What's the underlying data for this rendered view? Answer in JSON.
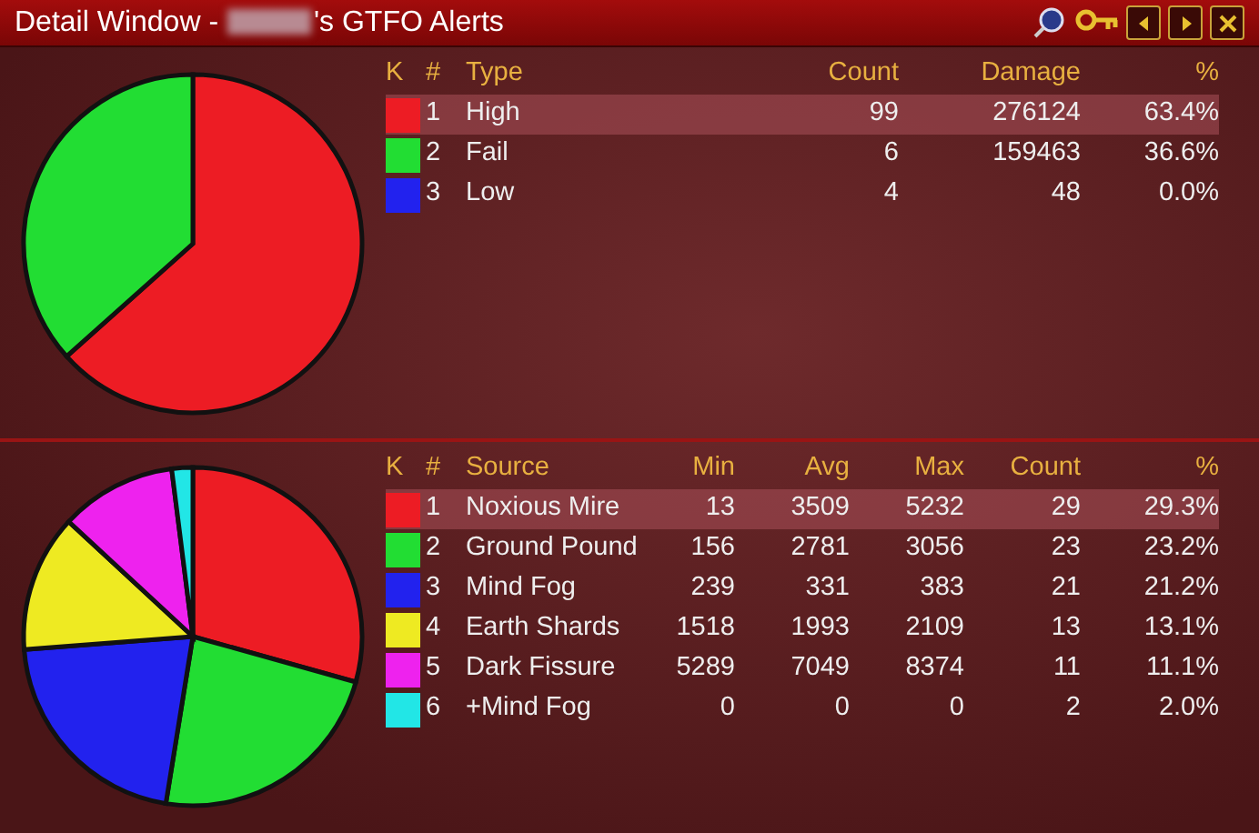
{
  "window": {
    "title_prefix": "Detail Window - ",
    "title_suffix": "'s GTFO Alerts"
  },
  "panels": [
    {
      "columns": [
        "K",
        "#",
        "Type",
        "Count",
        "Damage",
        "%"
      ],
      "rows": [
        {
          "color": "#ed1c24",
          "cells": [
            "",
            "1",
            "High",
            "99",
            "276124",
            "63.4%"
          ],
          "selected": true
        },
        {
          "color": "#22dd33",
          "cells": [
            "",
            "2",
            "Fail",
            "6",
            "159463",
            "36.6%"
          ],
          "selected": false
        },
        {
          "color": "#2222ee",
          "cells": [
            "",
            "3",
            "Low",
            "4",
            "48",
            "0.0%"
          ],
          "selected": false
        }
      ],
      "chart_data": {
        "type": "pie",
        "values": [
          63.4,
          36.6,
          0.0
        ]
      }
    },
    {
      "columns": [
        "K",
        "#",
        "Source",
        "Min",
        "Avg",
        "Max",
        "Count",
        "%"
      ],
      "rows": [
        {
          "color": "#ed1c24",
          "cells": [
            "",
            "1",
            "Noxious Mire",
            "13",
            "3509",
            "5232",
            "29",
            "29.3%"
          ],
          "selected": true
        },
        {
          "color": "#22dd33",
          "cells": [
            "",
            "2",
            "Ground Pound",
            "156",
            "2781",
            "3056",
            "23",
            "23.2%"
          ],
          "selected": false
        },
        {
          "color": "#2222ee",
          "cells": [
            "",
            "3",
            "Mind Fog",
            "239",
            "331",
            "383",
            "21",
            "21.2%"
          ],
          "selected": false
        },
        {
          "color": "#eeea22",
          "cells": [
            "",
            "4",
            "Earth Shards",
            "1518",
            "1993",
            "2109",
            "13",
            "13.1%"
          ],
          "selected": false
        },
        {
          "color": "#ee22ee",
          "cells": [
            "",
            "5",
            "Dark Fissure",
            "5289",
            "7049",
            "8374",
            "11",
            "11.1%"
          ],
          "selected": false
        },
        {
          "color": "#22e6e6",
          "cells": [
            "",
            "6",
            "+Mind Fog",
            "0",
            "0",
            "0",
            "2",
            "2.0%"
          ],
          "selected": false
        }
      ],
      "chart_data": {
        "type": "pie",
        "values": [
          29.3,
          23.2,
          21.2,
          13.1,
          11.1,
          2.0
        ]
      }
    }
  ]
}
